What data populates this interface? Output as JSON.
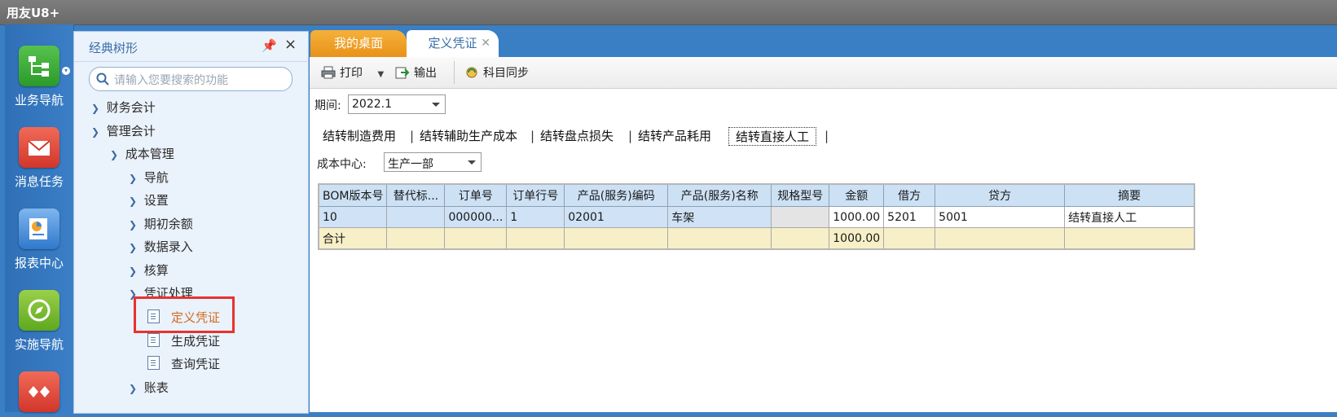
{
  "app": {
    "title": "用友U8+"
  },
  "launcher": [
    {
      "label": "业务导航",
      "color": "#3aa536"
    },
    {
      "label": "消息任务",
      "color": "#e0453a"
    },
    {
      "label": "报表中心",
      "color": "#3d86d6"
    },
    {
      "label": "实施导航",
      "color": "#6db52c"
    }
  ],
  "tree": {
    "title": "经典树形",
    "search_placeholder": "请输入您要搜索的功能",
    "nodes": {
      "finance": "财务会计",
      "mgmt": "管理会计",
      "cost": "成本管理",
      "nav": "导航",
      "settings": "设置",
      "opening": "期初余额",
      "entry": "数据录入",
      "calc": "核算",
      "voucher": "凭证处理",
      "define_voucher": "定义凭证",
      "gen_voucher": "生成凭证",
      "query_voucher": "查询凭证",
      "reports": "账表"
    }
  },
  "tabs": {
    "desktop": "我的桌面",
    "define": "定义凭证"
  },
  "toolbar": {
    "print": "打印",
    "export": "输出",
    "sync": "科目同步"
  },
  "period": {
    "label": "期间:",
    "value": "2022.1"
  },
  "subtabs": [
    "结转制造费用",
    "结转辅助生产成本",
    "结转盘点损失",
    "结转产品耗用",
    "结转直接人工"
  ],
  "cost_center": {
    "label": "成本中心:",
    "value": "生产一部"
  },
  "grid": {
    "headers": [
      "BOM版本号",
      "替代标...",
      "订单号",
      "订单行号",
      "产品(服务)编码",
      "产品(服务)名称",
      "规格型号",
      "金额",
      "借方",
      "贷方",
      "摘要"
    ],
    "rows": [
      [
        "10",
        "",
        "000000...",
        "1",
        "02001",
        "车架",
        "",
        "1000.00",
        "5201",
        "5001",
        "结转直接人工"
      ]
    ],
    "sum": [
      "合计",
      "",
      "",
      "",
      "",
      "",
      "",
      "1000.00",
      "",
      "",
      ""
    ]
  }
}
